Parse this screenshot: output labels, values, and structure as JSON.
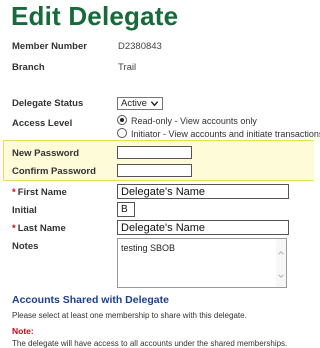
{
  "page": {
    "title": "Edit Delegate"
  },
  "member": {
    "number_label": "Member Number",
    "number_value": "D2380843",
    "branch_label": "Branch",
    "branch_value": "Trail"
  },
  "status": {
    "label": "Delegate Status",
    "selected": "Active"
  },
  "access": {
    "label": "Access Level",
    "options": [
      {
        "text": "Read-only - View accounts only",
        "selected": true
      },
      {
        "text": "Initiator - View accounts and initiate transactions",
        "selected": false
      }
    ]
  },
  "password": {
    "new_label": "New Password",
    "new_value": "",
    "confirm_label": "Confirm Password",
    "confirm_value": ""
  },
  "delegate": {
    "first_name_label": "First Name",
    "first_name_value": "Delegate's Name",
    "initial_label": "Initial",
    "initial_value": "B",
    "last_name_label": "Last Name",
    "last_name_value": "Delegate's Name",
    "required_marker": "*"
  },
  "notes": {
    "label": "Notes",
    "value": "testing SBOB"
  },
  "shared": {
    "title": "Accounts Shared with Delegate",
    "instruction": "Please select at least one membership to share with this delegate.",
    "note_label": "Note:",
    "note_text": "The delegate will have access to all accounts under the shared memberships."
  },
  "colors": {
    "title": "#176a3a",
    "section_title": "#1b3f8f",
    "required": "#d0021b",
    "highlight_bg": "#fdfbd8",
    "highlight_border": "#e6de58"
  },
  "icons": {
    "select_arrow": "chevron-down-icon",
    "scroll_up": "chevron-up-icon",
    "scroll_down": "chevron-down-icon"
  }
}
